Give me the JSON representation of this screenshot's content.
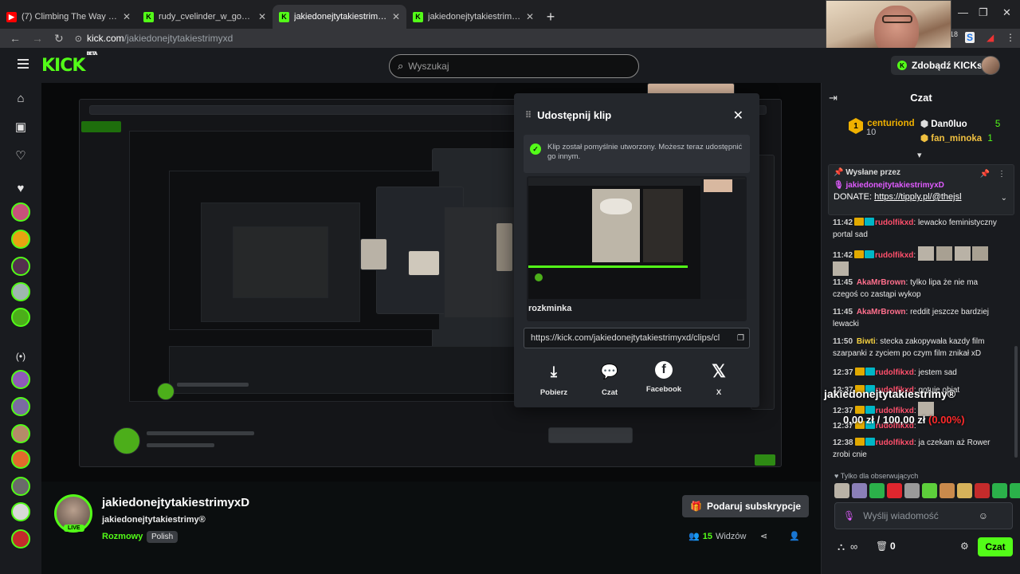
{
  "browser": {
    "tabs": [
      {
        "title": "(7) Climbing The Way Down",
        "favicon": "youtube",
        "active": false
      },
      {
        "title": "rudy_cvelinder_w_goglach - Wa",
        "favicon": "kick",
        "active": false
      },
      {
        "title": "jakiedonejtytakiestrimyxD Strea",
        "favicon": "kick",
        "active": true
      },
      {
        "title": "jakiedonejtytakiestrimyxD - Wa",
        "favicon": "kick",
        "active": false
      }
    ],
    "new_tab": "+",
    "url_host": "kick.com",
    "url_path": "/jakiedonejtytakiestrimyxd",
    "ext_badge": "18"
  },
  "header": {
    "logo": "KICK",
    "logo_beta": "BETA",
    "search_placeholder": "Wyszukaj",
    "kicks_button": "Zdobądź KICKs"
  },
  "clip_modal": {
    "title": "Udostępnij klip",
    "success": "Klip został pomyślnie utworzony. Możesz teraz udostępnić go innym.",
    "clip_title": "rozkminka",
    "clip_url": "https://kick.com/jakiedonejtytakiestrimyxd/clips/cl",
    "actions": [
      {
        "label": "Pobierz",
        "icon": "download-icon"
      },
      {
        "label": "Czat",
        "icon": "chat-icon"
      },
      {
        "label": "Facebook",
        "icon": "facebook-icon"
      },
      {
        "label": "X",
        "icon": "x-icon"
      }
    ]
  },
  "stream": {
    "channel": "jakiedonejtytakiestrimyxD",
    "title": "jakiedonejtytakiestrimy®",
    "category": "Rozmowy",
    "language": "Polish",
    "live_badge": "LIVE",
    "subscribe_button": "Podaruj subskrypcje",
    "viewers_count": "15",
    "viewers_label": "Widzów"
  },
  "chat": {
    "title": "Czat",
    "leaderboard": [
      {
        "rank": "1",
        "name": "centuriond",
        "count": "10"
      },
      {
        "name": "Dan0luo",
        "count": "5"
      },
      {
        "name": "fan_minoka",
        "count": "1"
      }
    ],
    "pinned": {
      "label": "Wysłane przez",
      "user": "jakiedonejtytakiestrimyxD",
      "text_prefix": "DONATE: ",
      "link": "https://tipply.pl/@thejsl"
    },
    "messages": [
      {
        "time": "11:42",
        "user": "rudolfikxd",
        "color": "#ff4f6b",
        "text": "lewacko feministyczny portal sad",
        "badges": true
      },
      {
        "time": "11:42",
        "user": "rudolfikxd",
        "color": "#ff4f6b",
        "text": "",
        "badges": true
      },
      {
        "time": "11:45",
        "user": "AkaMrBrown",
        "color": "#ff6f8c",
        "text": "tylko lipa że nie ma czegoś co zastąpi wykop",
        "badges": false
      },
      {
        "time": "11:45",
        "user": "AkaMrBrown",
        "color": "#ff6f8c",
        "text": "reddit jeszcze bardziej lewacki",
        "badges": false
      },
      {
        "time": "11:50",
        "user": "Biwti",
        "color": "#f4d03f",
        "text": "stecka zakopywała kazdy film szarpanki z zyciem po czym film znikał xD",
        "badges": false
      },
      {
        "time": "12:37",
        "user": "rudolfikxd",
        "color": "#ff4f6b",
        "text": "jestem sad",
        "badges": true
      },
      {
        "time": "12:37",
        "user": "rudolfikxd",
        "color": "#ff4f6b",
        "text": "gotuje obiat",
        "badges": true
      },
      {
        "time": "12:37",
        "user": "rudolfikxd",
        "color": "#ff4f6b",
        "text": "",
        "badges": true
      },
      {
        "time": "12:37",
        "user": "rudolfikxd",
        "color": "#ff4f6b",
        "text": "",
        "badges": true
      },
      {
        "time": "12:38",
        "user": "rudolfikxd",
        "color": "#ff4f6b",
        "text": "ja czekam aż Rower zrobi cnie",
        "badges": true
      }
    ],
    "followers_only": "Tylko dla obserwujących",
    "input_placeholder": "Wyślij wiadomość",
    "send_button": "Czat",
    "kicks_count": "0"
  },
  "overlay": {
    "name": "jakiedonejtytakiestrimy®",
    "goal_current": "0,00 zł",
    "goal_sep": "/",
    "goal_target": "100,00 zł",
    "goal_pct": "(0.00%)"
  },
  "colors": {
    "brand": "#53fc18",
    "bg": "#0b0e0f",
    "panel": "#191b1f"
  }
}
